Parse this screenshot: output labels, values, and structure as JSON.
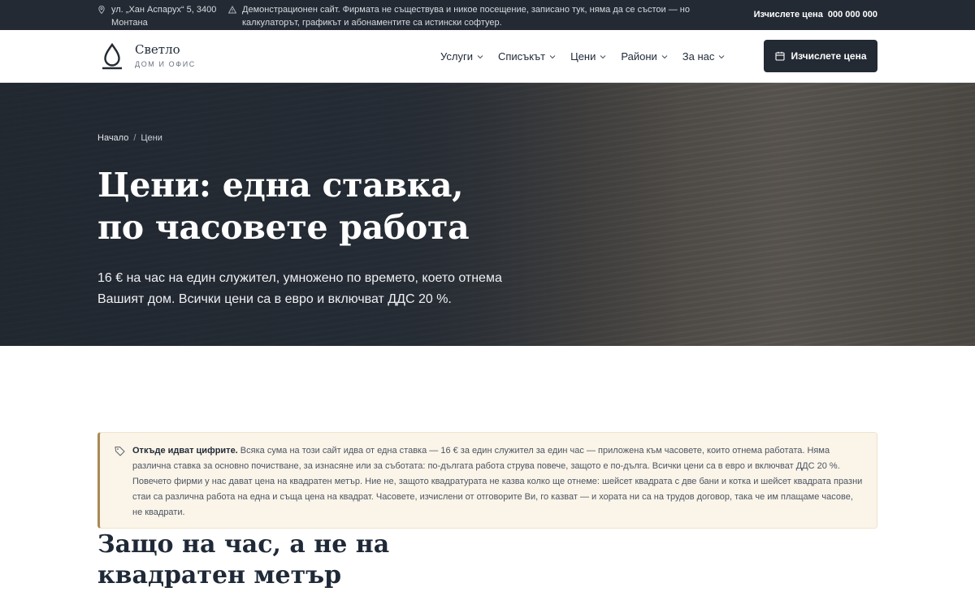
{
  "topbar": {
    "address": "ул. „Хан Аспарух“ 5, 3400 Монтана",
    "notice": "Демонстрационен сайт. Фирмата не съществува и никое посещение, записано тук, няма да се състои — но калкулаторът, графикът и абонаментите са истински софтуер.",
    "cta_label": "Изчислете цена",
    "phone": "000 000 000"
  },
  "header": {
    "brand_name": "Светло",
    "brand_tagline": "ДОМ И ОФИС",
    "nav": [
      {
        "label": "Услуги"
      },
      {
        "label": "Списъкът"
      },
      {
        "label": "Цени"
      },
      {
        "label": "Райони"
      },
      {
        "label": "За нас"
      }
    ],
    "button_label": "Изчислете цена"
  },
  "hero": {
    "breadcrumb": {
      "home": "Начало",
      "sep": "/",
      "current": "Цени"
    },
    "title_line1": "Цени: една ставка,",
    "title_line2": "по часовете работа",
    "lead": "16 € на час на един служител, умножено по времето, което отнема Вашият дом. Всички цени са в евро и включват ДДС 20 %."
  },
  "callout": {
    "heading": "Откъде идват цифрите.",
    "body": " Всяка сума на този сайт идва от една ставка — 16 € за един служител за един час — приложена към часовете, които отнема работата. Няма различна ставка за основно почистване, за изнасяне или за съботата: по-дългата работа струва повече, защото е по-дълга. Всички цени са в евро и включват ДДС 20 %. Повечето фирми у нас дават цена на квадратен метър. Ние не, защото квадратурата не казва колко ще отнеме: шейсет квадрата с две бани и котка и шейсет квадрата празни стаи са различна работа на една и съща цена на квадрат. Часовете, изчислени от отговорите Ви, го казват — и хората ни са на трудов договор, така че им плащаме часове, не квадрати."
  },
  "section": {
    "heading": "Защо на час, а не на квадратен метър"
  },
  "icons": {
    "address": "map-pin-icon",
    "notice": "warning-icon",
    "logo": "water-drop-icon",
    "nav_dropdown": "chevron-down-icon",
    "button": "calendar-icon",
    "callout": "price-tag-icon"
  },
  "colors": {
    "dark": "#232a33",
    "callout_bg": "#fbf4e8",
    "callout_accent": "#a88a55"
  }
}
